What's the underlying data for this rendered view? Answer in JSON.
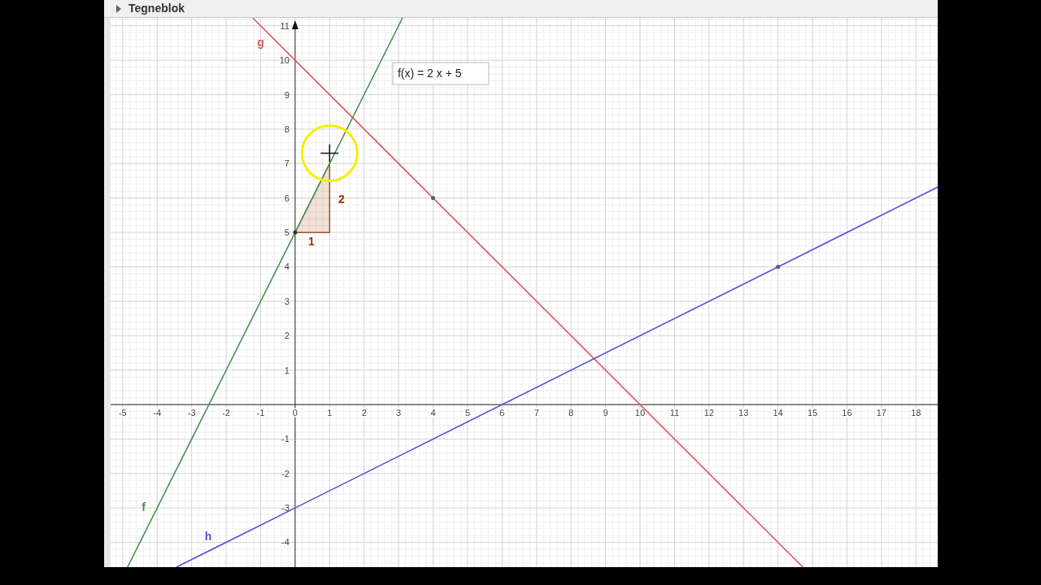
{
  "panel": {
    "title": "Tegneblok",
    "expanded": false
  },
  "chart_data": {
    "type": "line",
    "grid": true,
    "x": [
      -4.86,
      -3.44,
      -1.23,
      0,
      3.115,
      14.72,
      18.63
    ],
    "series": [
      {
        "name": "f",
        "color": "#4b9150",
        "values": [
          -4.72,
          -1.88,
          2.54,
          5,
          11.23,
          null,
          null
        ]
      },
      {
        "name": "g",
        "color": "#d45c5c",
        "values": [
          null,
          null,
          11.23,
          10,
          6.885,
          -4.72,
          null
        ]
      },
      {
        "name": "h",
        "color": "#5a50d8",
        "values": [
          null,
          -4.72,
          -3.615,
          -3,
          -1.4425,
          4.36,
          6.315
        ]
      }
    ],
    "xlim": [
      -5.35,
      18.63
    ],
    "ylim": [
      -4.72,
      11.23
    ],
    "xticks": [
      -5,
      -4,
      -3,
      -2,
      -1,
      0,
      1,
      2,
      3,
      4,
      5,
      6,
      7,
      8,
      9,
      10,
      11,
      12,
      13,
      14,
      15,
      16,
      17,
      18
    ],
    "yticks": [
      -4,
      -3,
      -2,
      -1,
      1,
      2,
      3,
      4,
      5,
      6,
      7,
      8,
      9,
      10,
      11
    ],
    "annotations": [
      "f(x) = 2 x + 5",
      "2",
      "1"
    ]
  }
}
